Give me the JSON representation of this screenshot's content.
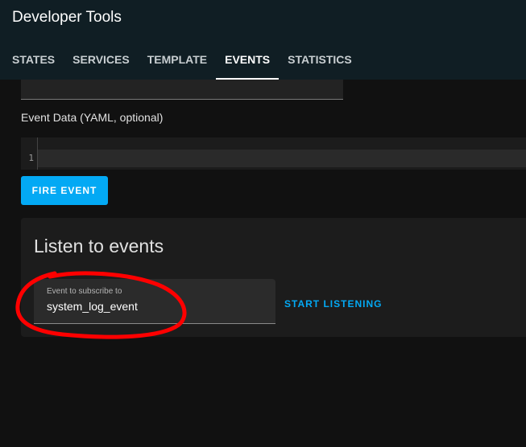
{
  "header": {
    "title": "Developer Tools",
    "tabs": [
      {
        "label": "STATES"
      },
      {
        "label": "SERVICES"
      },
      {
        "label": "TEMPLATE"
      },
      {
        "label": "EVENTS"
      },
      {
        "label": "STATISTICS"
      }
    ],
    "active_tab": "EVENTS"
  },
  "fire_section": {
    "event_data_label": "Event Data (YAML, optional)",
    "editor_line_number": "1",
    "fire_button_label": "FIRE EVENT"
  },
  "listen_card": {
    "title": "Listen to events",
    "subscribe_label": "Event to subscribe to",
    "subscribe_value": "system_log_event",
    "listen_button_label": "START LISTENING"
  },
  "colors": {
    "accent": "#03a9f4",
    "header_bg": "#101e24",
    "annotation": "#ff0000"
  }
}
